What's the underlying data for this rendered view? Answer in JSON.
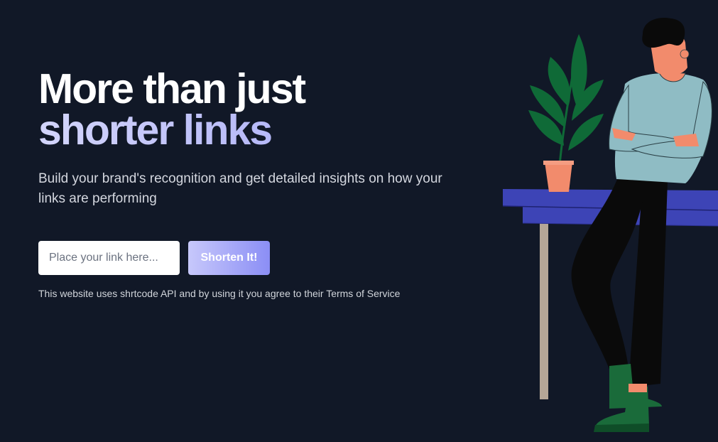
{
  "hero": {
    "headline_line1": "More than just",
    "headline_line2": "shorter links",
    "subtitle": "Build your brand's recognition and get detailed insights on how your links are performing"
  },
  "form": {
    "input_placeholder": "Place your link here...",
    "input_value": "",
    "button_label": "Shorten It!"
  },
  "notice": "This website uses shrtcode API and by using it you agree to their Terms of Service",
  "colors": {
    "background": "#111827",
    "accent_start": "#d3d5fb",
    "accent_end": "#8b8ef5",
    "table": "#3d44b6",
    "sweater": "#8fbcc4",
    "plant": "#0f6a37",
    "pot": "#f28b6c"
  },
  "illustration": {
    "icon": "person-leaning-on-table-illustration"
  }
}
